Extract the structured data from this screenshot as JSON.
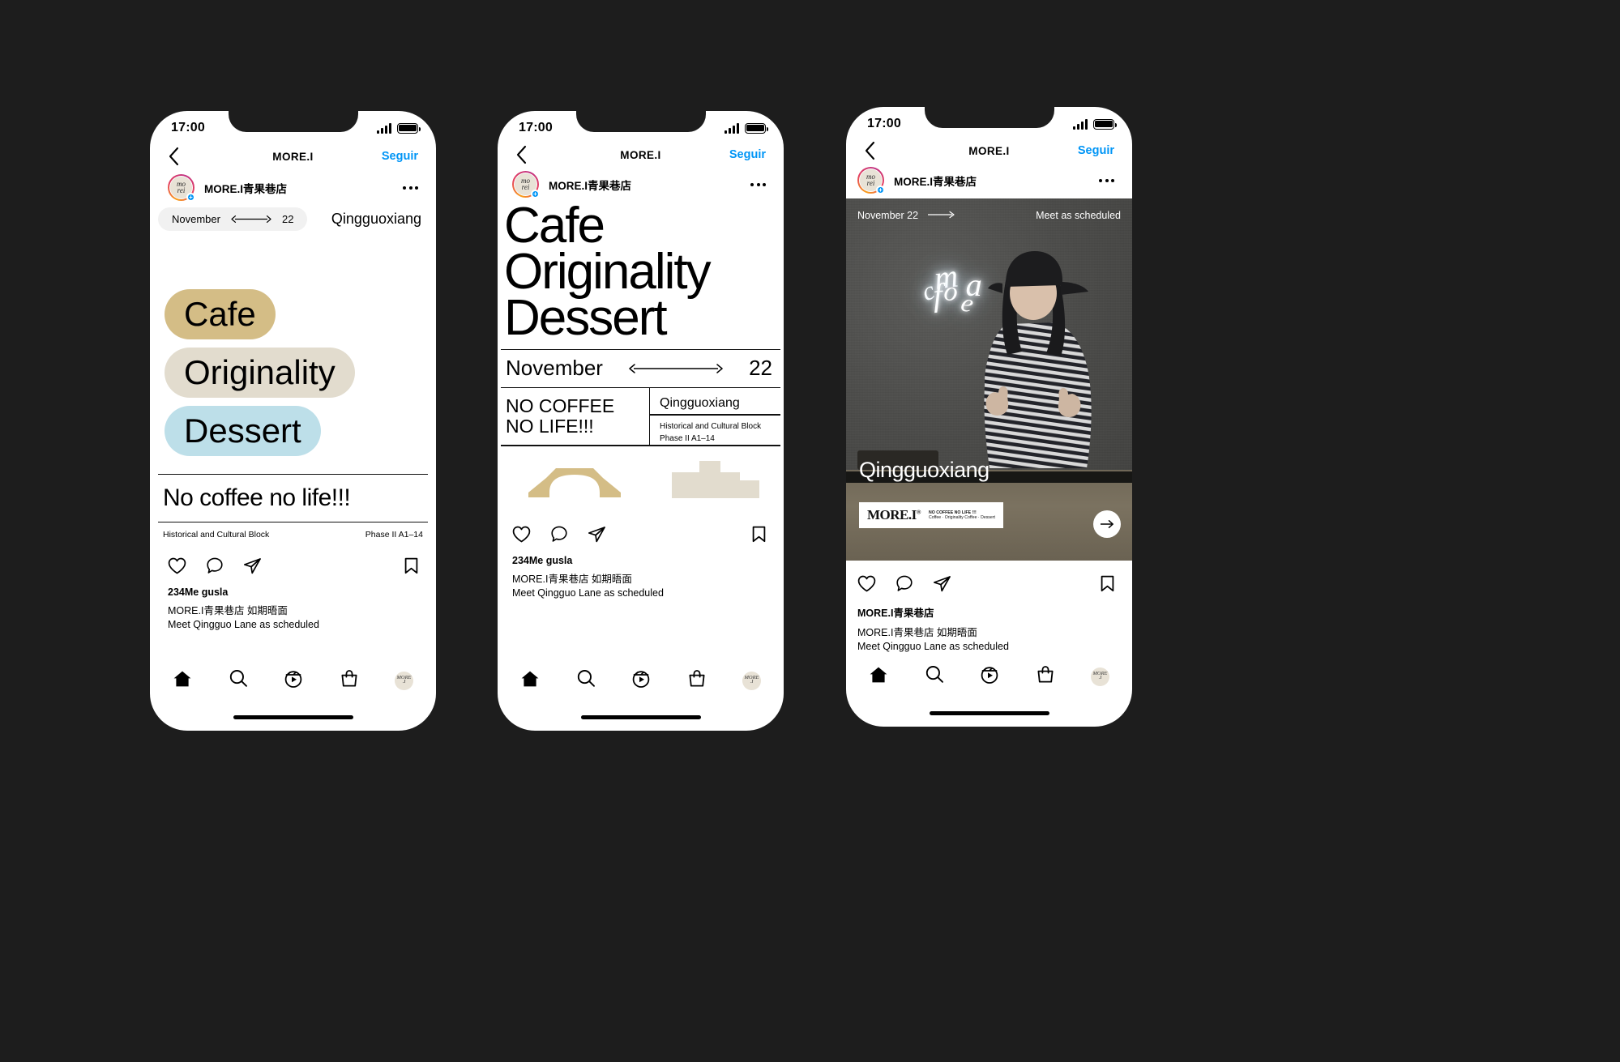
{
  "common": {
    "status_time": "17:00",
    "nav_title": "MORE.I",
    "follow_label": "Seguir",
    "account_name": "MORE.I青果巷店",
    "back_icon": "chevron-left-icon",
    "more_icon": "more-options-icon",
    "tabbar": {
      "home": "home-icon",
      "search": "search-icon",
      "reels": "reels-icon",
      "shop": "shop-icon",
      "profile": "profile-avatar"
    },
    "actions": {
      "like": "heart-icon",
      "comment": "comment-icon",
      "share": "share-icon",
      "save": "bookmark-icon"
    },
    "avatar_glyph": "mo\nrei"
  },
  "phone1": {
    "date_month": "November",
    "date_day": "22",
    "place": "Qingguoxiang",
    "pills": [
      {
        "label": "Cafe",
        "color": "#d4bd86"
      },
      {
        "label": "Originality",
        "color": "#e2dcce"
      },
      {
        "label": "Dessert",
        "color": "#bddfe9"
      }
    ],
    "slogan": "No coffee no life!!!",
    "meta_left": "Historical and Cultural Block",
    "meta_right": "Phase II   A1–14",
    "likes": "234Me gusla",
    "caption_line1": "MORE.I青果巷店 如期晤面",
    "caption_line2": "Meet Qingguo Lane as scheduled"
  },
  "phone2": {
    "headline": [
      "Cafe",
      "Originality",
      "Dessert"
    ],
    "date_month": "November",
    "date_day": "22",
    "slogan_line1": "NO COFFEE",
    "slogan_line2": "NO LIFE!!!",
    "place": "Qingguoxiang",
    "meta_line1": "Historical and Cultural Block",
    "meta_line2": "Phase II   A1–14",
    "likes": "234Me gusla",
    "caption_line1": "MORE.I青果巷店 如期晤面",
    "caption_line2": "Meet Qingguo Lane as scheduled"
  },
  "phone3": {
    "overlay_date": "November 22",
    "overlay_status": "Meet as scheduled",
    "neon_text": "more\ncafe",
    "photo_title": "Qingguoxiang",
    "logo_mark": "MORE.I",
    "logo_sup": "®",
    "logo_line1": "NO COFFEE   NO LIFE !!!",
    "logo_line2": "Coffee · Originality Coffee · Dessert",
    "next_icon": "arrow-right-icon",
    "likes": "MORE.I青果巷店",
    "caption_line1": "MORE.I青果巷店 如期晤面",
    "caption_line2": "Meet Qingguo Lane as scheduled"
  },
  "colors": {
    "background": "#1d1d1d",
    "accent_blue": "#0095f6",
    "pill_cafe": "#d4bd86",
    "pill_originality": "#e2dcce",
    "pill_dessert": "#bddfe9"
  }
}
